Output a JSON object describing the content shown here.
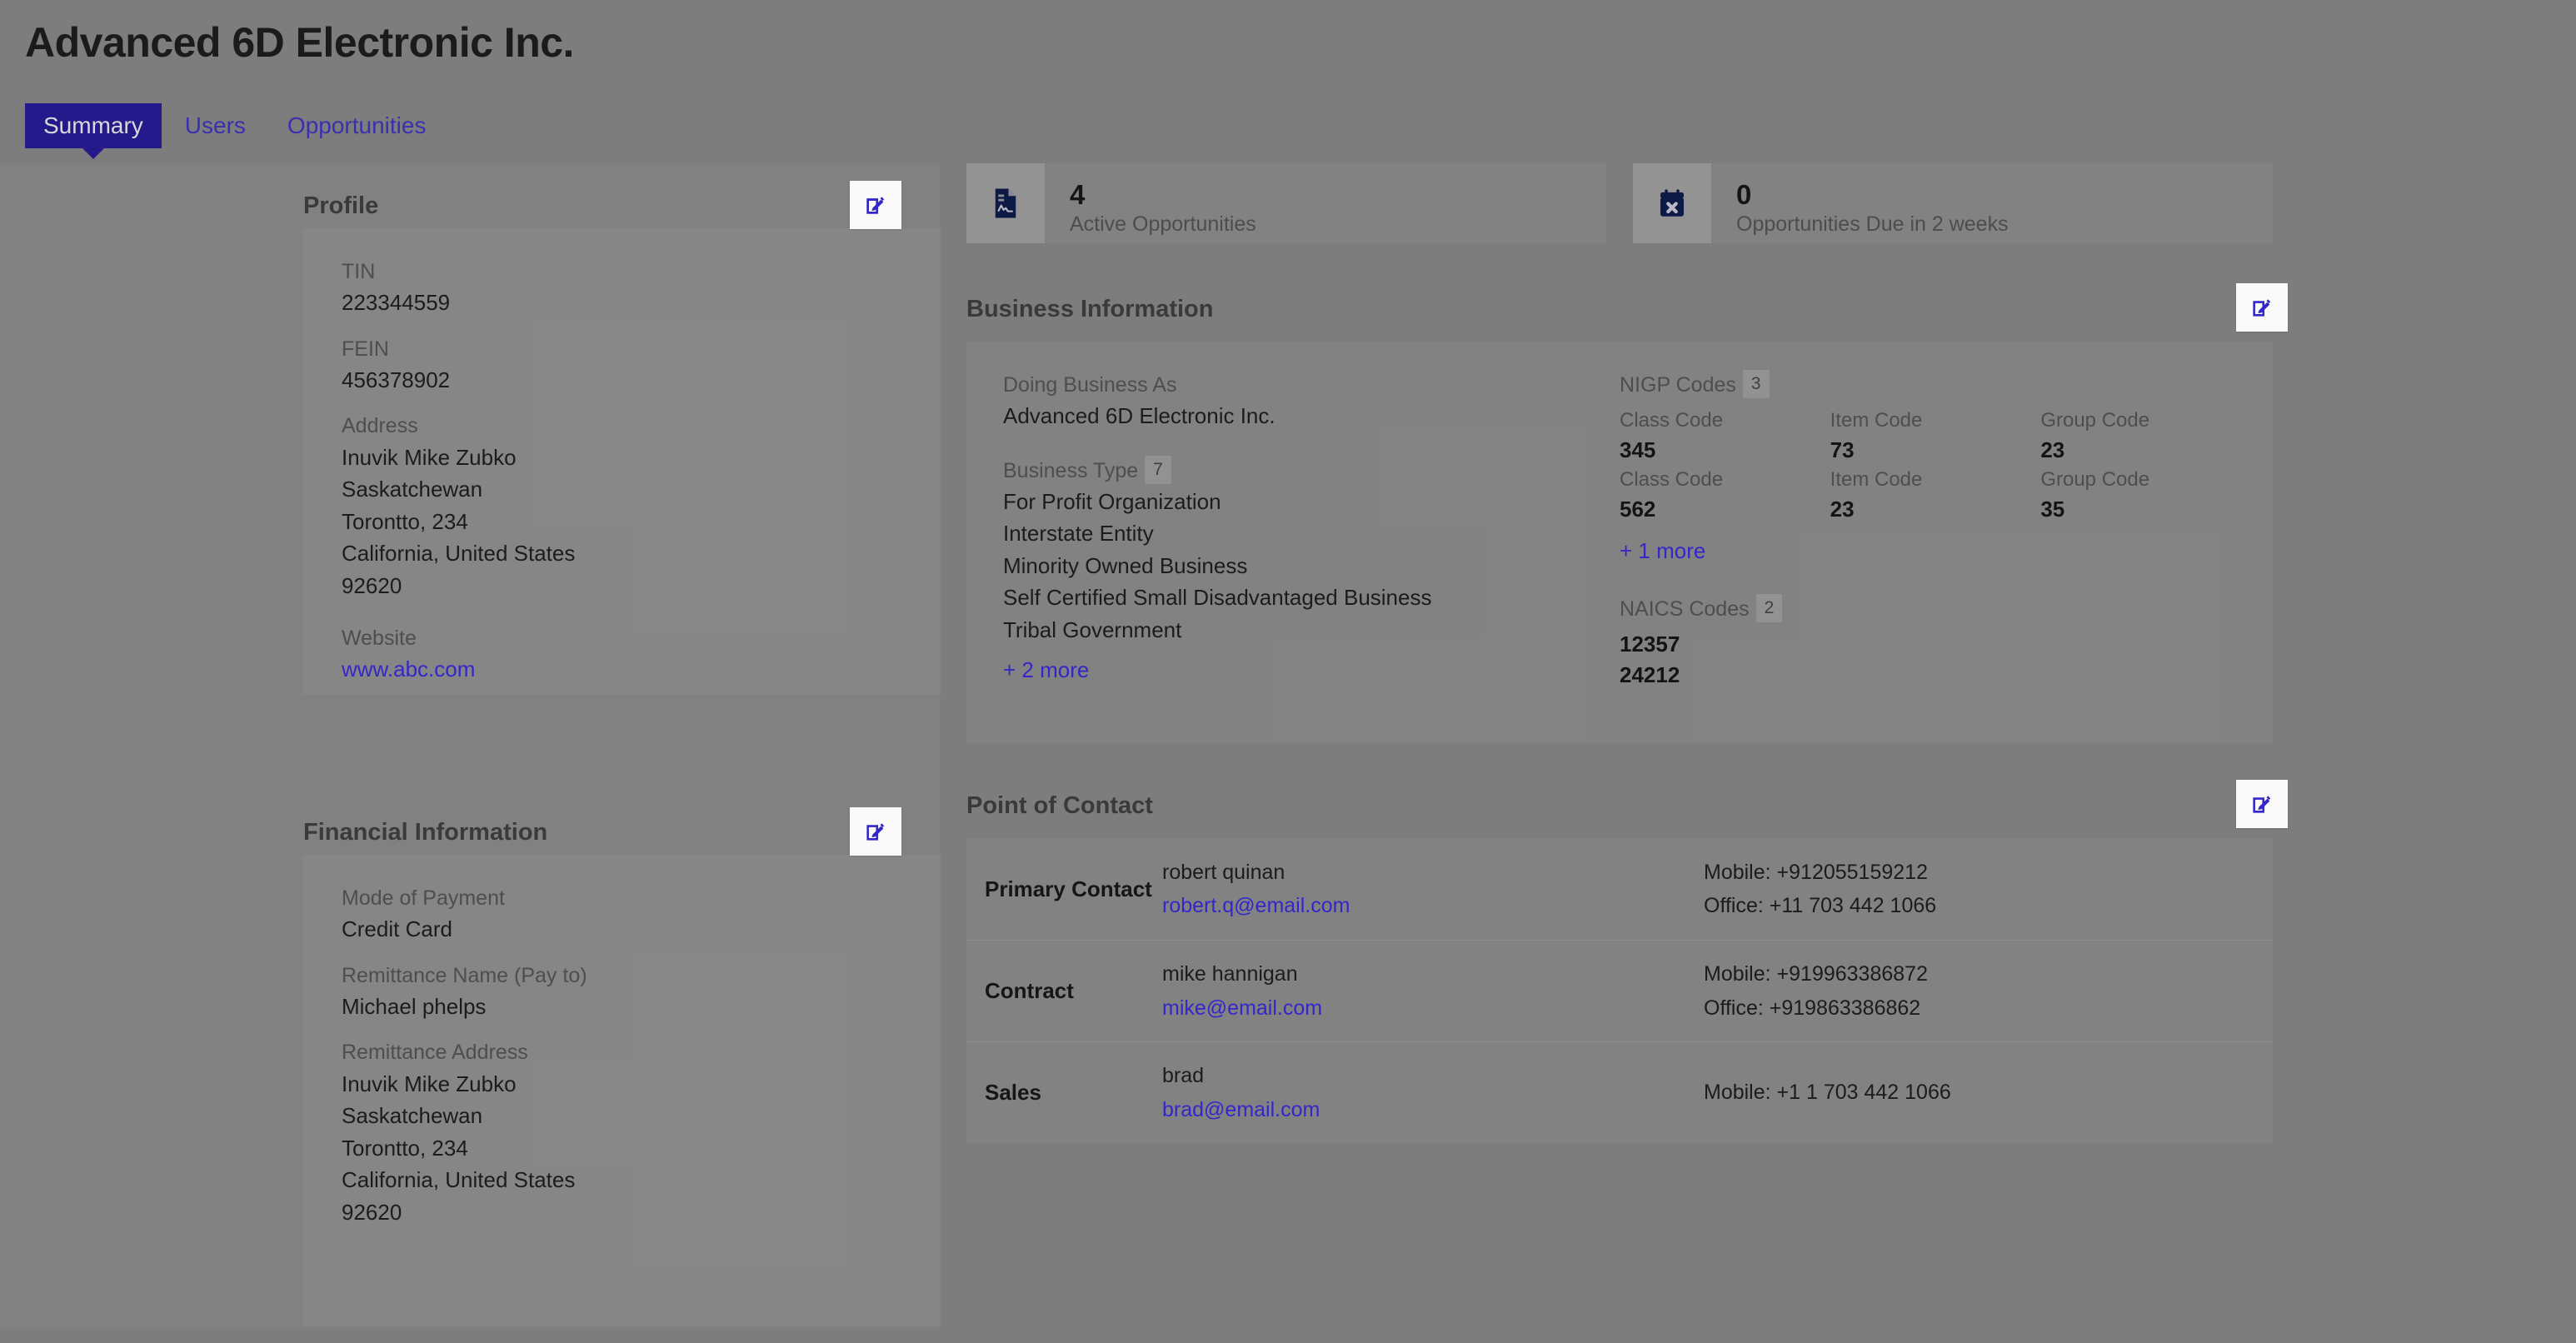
{
  "header": {
    "company_title": "Advanced 6D Electronic Inc.",
    "tabs": [
      {
        "label": "Summary",
        "active": true
      },
      {
        "label": "Users",
        "active": false
      },
      {
        "label": "Opportunities",
        "active": false
      }
    ]
  },
  "colors": {
    "page_background": "#7d7d7d",
    "accent_indigo": "#241a8c",
    "link_blue": "#3426c9",
    "icon_navy": "#0e1a46",
    "edit_button_background": "#fafafa"
  },
  "profile": {
    "title": "Profile",
    "edit_icon": "edit-pencil-icon",
    "fields": [
      {
        "label": "TIN",
        "value": "223344559"
      },
      {
        "label": "FEIN",
        "value": "456378902"
      },
      {
        "label": "Address",
        "value": "Inuvik Mike Zubko\nSaskatchewan\nTorontto, 234\nCalifornia, United States\n92620"
      }
    ],
    "website_label": "Website",
    "website_value": "www.abc.com"
  },
  "financial": {
    "title": "Financial Information",
    "edit_icon": "edit-pencil-icon",
    "fields": [
      {
        "label": "Mode of Payment",
        "value": "Credit Card"
      },
      {
        "label": "Remittance Name (Pay to)",
        "value": "Michael phelps"
      },
      {
        "label": "Remittance Address",
        "value": "Inuvik Mike Zubko\nSaskatchewan\nTorontto, 234\nCalifornia, United States\n92620"
      }
    ]
  },
  "stats": [
    {
      "icon": "document-chart-icon",
      "number": "4",
      "label": "Active Opportunities"
    },
    {
      "icon": "calendar-x-icon",
      "number": "0",
      "label": "Opportunities Due in 2 weeks"
    }
  ],
  "business_information": {
    "title": "Business Information",
    "edit_icon": "edit-pencil-icon",
    "doing_business_as_label": "Doing Business As",
    "doing_business_as_value": "Advanced 6D Electronic Inc.",
    "business_type_label": "Business Type",
    "business_type_count": "7",
    "business_types": [
      "For Profit Organization",
      "Interstate Entity",
      "Minority Owned Business",
      "Self Certified Small Disadvantaged Business",
      "Tribal Government"
    ],
    "business_type_more": "+ 2 more",
    "nigp_label": "NIGP Codes",
    "nigp_count": "3",
    "nigp_headers": [
      "Class Code",
      "Item Code",
      "Group Code"
    ],
    "nigp_rows": [
      {
        "class_code": "345",
        "item_code": "73",
        "group_code": "23"
      },
      {
        "class_code": "562",
        "item_code": "23",
        "group_code": "35"
      }
    ],
    "nigp_more": "+ 1 more",
    "naics_label": "NAICS Codes",
    "naics_count": "2",
    "naics_values": [
      "12357",
      "24212"
    ]
  },
  "point_of_contact": {
    "title": "Point of Contact",
    "edit_icon": "edit-pencil-icon",
    "rows": [
      {
        "type": "Primary Contact",
        "name": "robert quinan",
        "email": "robert.q@email.com",
        "mobile": "Mobile: +912055159212",
        "office": "Office: +11 703 442 1066"
      },
      {
        "type": "Contract",
        "name": "mike hannigan",
        "email": "mike@email.com",
        "mobile": "Mobile: +919963386872",
        "office": "Office: +919863386862"
      },
      {
        "type": "Sales",
        "name": "brad",
        "email": "brad@email.com",
        "mobile": "Mobile: +1 1 703 442 1066",
        "office": ""
      }
    ]
  }
}
